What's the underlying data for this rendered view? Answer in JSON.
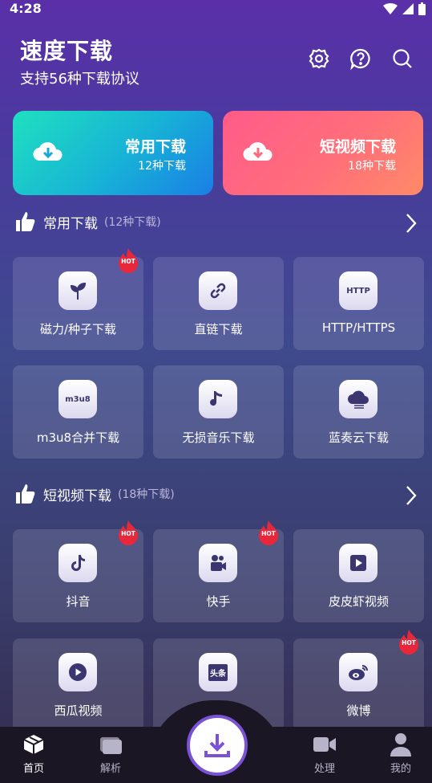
{
  "status_bar": {
    "time": "4:28"
  },
  "header": {
    "title": "速度下载",
    "subtitle": "支持56种下载协议"
  },
  "big_cards": [
    {
      "label": "常用下载",
      "count": "12种下载",
      "icon": "cloud-download-icon"
    },
    {
      "label": "短视频下载",
      "count": "18种下载",
      "icon": "cloud-download-icon"
    }
  ],
  "sections": [
    {
      "title": "常用下载",
      "count": "(12种下载)",
      "items": [
        {
          "label": "磁力/种子下载",
          "icon": "sprout-icon",
          "hot": true
        },
        {
          "label": "直链下载",
          "icon": "link-icon",
          "hot": false
        },
        {
          "label": "HTTP/HTTPS",
          "icon": "http-icon",
          "icon_text": "HTTP",
          "hot": false
        },
        {
          "label": "m3u8合并下载",
          "icon": "m3u8-icon",
          "icon_text": "m3u8",
          "hot": false
        },
        {
          "label": "无损音乐下载",
          "icon": "music-note-icon",
          "hot": false
        },
        {
          "label": "蓝奏云下载",
          "icon": "cloud-icon",
          "hot": false
        }
      ]
    },
    {
      "title": "短视频下载",
      "count": "(18种下载)",
      "items": [
        {
          "label": "抖音",
          "icon": "tiktok-icon",
          "hot": true
        },
        {
          "label": "快手",
          "icon": "kuaishou-icon",
          "hot": true
        },
        {
          "label": "皮皮虾视频",
          "icon": "play-square-icon",
          "hot": false
        },
        {
          "label": "西瓜视频",
          "icon": "play-circle-icon",
          "hot": false
        },
        {
          "label": "",
          "icon": "toutiao-icon",
          "icon_text": "头条",
          "hot": false
        },
        {
          "label": "微博",
          "icon": "weibo-icon",
          "hot": true
        }
      ]
    }
  ],
  "hot_badge": "HOT",
  "nav": {
    "items": [
      {
        "label": "首页",
        "icon": "home-box-icon",
        "active": true
      },
      {
        "label": "解析",
        "icon": "folders-icon",
        "active": false
      },
      {
        "label": "处理",
        "icon": "video-camera-icon",
        "active": false
      },
      {
        "label": "我的",
        "icon": "user-icon",
        "active": false
      }
    ],
    "center_icon": "download-icon"
  },
  "colors": {
    "accent": "#7b52d6",
    "card_left": "#17b2d6",
    "card_right": "#ff6e7a",
    "hot": "#e8283a"
  }
}
